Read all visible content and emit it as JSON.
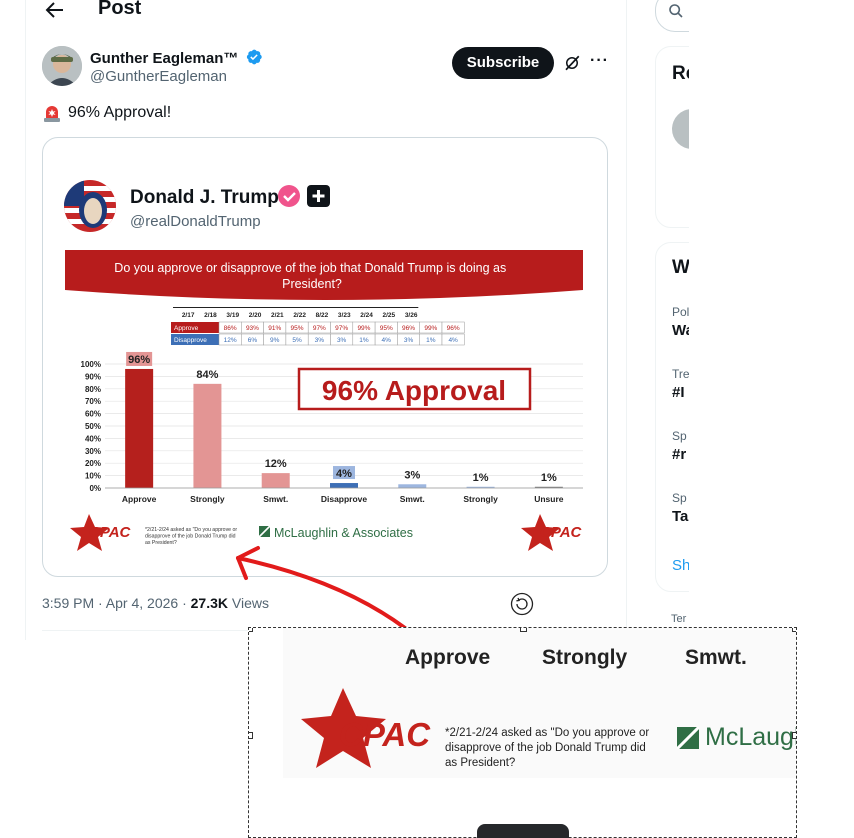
{
  "header": {
    "title": "Post"
  },
  "author": {
    "name": "Gunther Eagleman™",
    "handle": "@GuntherEagleman",
    "subscribe_label": "Subscribe",
    "more_label": "···"
  },
  "tweet": {
    "text": "96% Approval!"
  },
  "embedded": {
    "name": "Donald J. Trump",
    "handle": "@realDonaldTrump",
    "banner": "Do you approve or disapprove of the job that Donald Trump is doing as President?",
    "table": {
      "dates": [
        "2/17",
        "2/18",
        "3/19",
        "2/20",
        "2/21",
        "2/22",
        "8/22",
        "3/23",
        "2/24",
        "2/25",
        "3/26"
      ],
      "approve_label": "Approve",
      "approve": [
        "86%",
        "93%",
        "91%",
        "95%",
        "97%",
        "97%",
        "99%",
        "95%",
        "96%",
        "99%",
        "96%"
      ],
      "disapprove_label": "Disapprove",
      "disapprove": [
        "12%",
        "6%",
        "9%",
        "5%",
        "3%",
        "3%",
        "1%",
        "4%",
        "3%",
        "1%",
        "4%"
      ]
    },
    "approval_box": "96% Approval",
    "logo_left": "CPAC",
    "logo_right": "CPAC",
    "footnote": "*2/21-2/24 asked as \"Do you approve or disapprove of the job Donald Trump did as President?",
    "pollster": "McLaughlin & Associates"
  },
  "chart_data": {
    "type": "bar",
    "categories": [
      "Approve",
      "Strongly",
      "Smwt.",
      "Disapprove",
      "Smwt.",
      "Strongly",
      "Unsure"
    ],
    "values": [
      96,
      84,
      12,
      4,
      3,
      1,
      1
    ],
    "value_labels": [
      "96%",
      "84%",
      "12%",
      "4%",
      "3%",
      "1%",
      "1%"
    ],
    "colors": [
      "#b5201d",
      "#e39594",
      "#e39594",
      "#3d6fb6",
      "#9db6df",
      "#9db6df",
      "#7f7f7f"
    ],
    "ylim": [
      0,
      100
    ],
    "yticks": [
      "0%",
      "10%",
      "20%",
      "30%",
      "40%",
      "50%",
      "60%",
      "70%",
      "80%",
      "90%",
      "100%"
    ],
    "grid": true
  },
  "meta": {
    "time": "3:59 PM · Apr 4, 2026 · ",
    "views_count": "27.3K",
    "views_label": " Views"
  },
  "sidebar": {
    "box1_title": "Re",
    "box2_title": "W",
    "items": [
      {
        "small": "Pol",
        "big": "Wa"
      },
      {
        "small": "Tre",
        "big": "#I"
      },
      {
        "small": "Sp",
        "big": "#r"
      },
      {
        "small": "Sp",
        "big": "Ta"
      }
    ],
    "show_more": "Sh",
    "terms": "Ter"
  },
  "zoom": {
    "labels": [
      "Approve",
      "Strongly",
      "Smwt."
    ],
    "logo": "CPAC",
    "footnote": "*2/21-2/24 asked as \"Do you approve or disapprove of the job Donald Trump did as President?",
    "pollster_partial": "McLaugh"
  },
  "colors": {
    "accent": "#1d9bf0",
    "cpac_red": "#c4231d",
    "banner_red": "#b71c1c"
  }
}
